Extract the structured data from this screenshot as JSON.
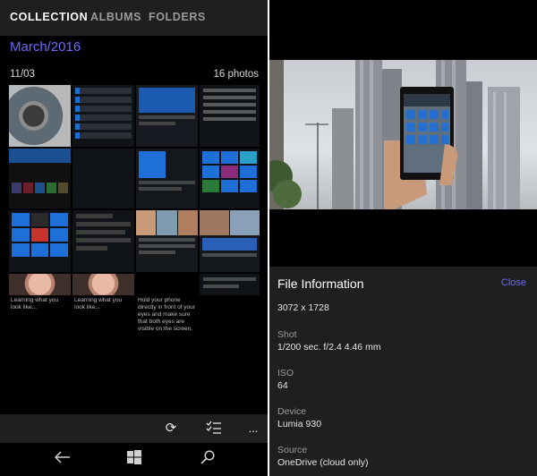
{
  "tabs": {
    "collection": "COLLECTION",
    "albums": "ALBUMS",
    "folders": "FOLDERS"
  },
  "collection": {
    "month": "March/2016",
    "day": "11/03",
    "photo_count": "16 photos",
    "captions": {
      "c1": "Learning what you look like...",
      "c2": "Learning what you look like...",
      "c3": "Hold your phone directly in front of your eyes and make sure that both eyes are visible on the screen."
    }
  },
  "appbar": {
    "sync_icon": "sync-icon",
    "select_icon": "select-list-icon",
    "more": "..."
  },
  "navbar": {
    "back_icon": "back-icon",
    "start_icon": "windows-start-icon",
    "search_icon": "search-icon"
  },
  "file_info": {
    "title": "File Information",
    "close": "Close",
    "dimensions": "3072 x 1728",
    "shot_label": "Shot",
    "shot_value": "1/200 sec. f/2.4 4.46 mm",
    "iso_label": "ISO",
    "iso_value": "64",
    "device_label": "Device",
    "device_value": "Lumia 930",
    "source_label": "Source",
    "source_value": "OneDrive (cloud only)"
  },
  "colors": {
    "accent": "#6b6bff",
    "bar": "#1f1f1f",
    "background": "#000000"
  }
}
